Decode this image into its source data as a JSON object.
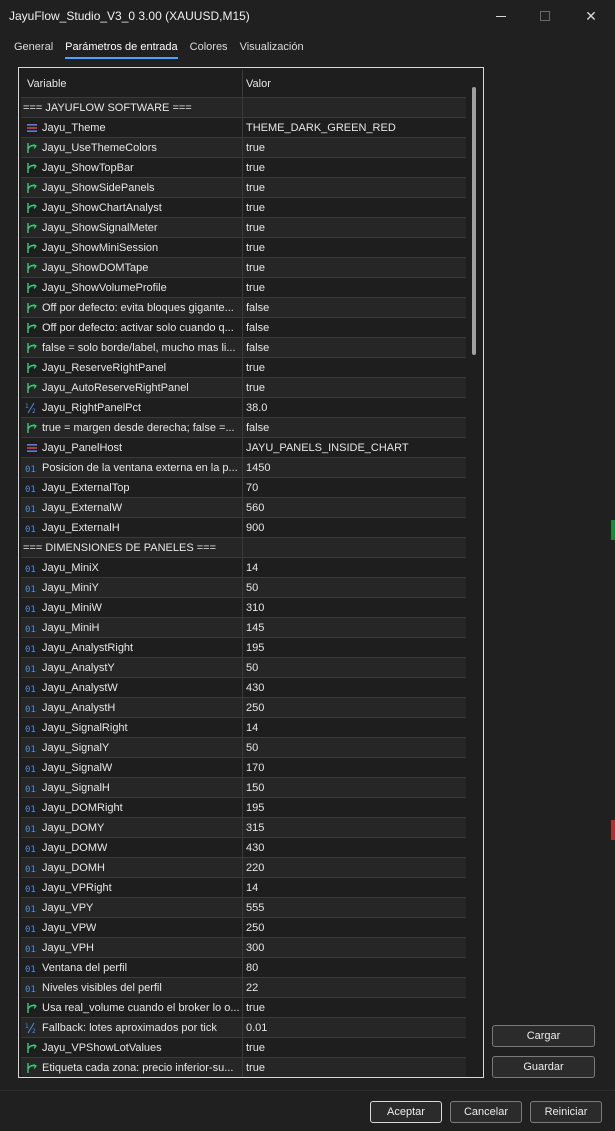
{
  "window": {
    "title": "JayuFlow_Studio_V3_0 3.00 (XAUUSD,M15)"
  },
  "tabs": [
    {
      "label": "General"
    },
    {
      "label": "Parámetros de entrada"
    },
    {
      "label": "Colores"
    },
    {
      "label": "Visualización"
    }
  ],
  "active_tab": "Parámetros de entrada",
  "table": {
    "col_variable": "Variable",
    "col_valor": "Valor",
    "rows": [
      {
        "icon": "none",
        "name": "=== JAYUFLOW SOFTWARE ===",
        "value": ""
      },
      {
        "icon": "enum-icon",
        "name": "Jayu_Theme",
        "value": "THEME_DARK_GREEN_RED"
      },
      {
        "icon": "bool-icon",
        "name": "Jayu_UseThemeColors",
        "value": "true"
      },
      {
        "icon": "bool-icon",
        "name": "Jayu_ShowTopBar",
        "value": "true"
      },
      {
        "icon": "bool-icon",
        "name": "Jayu_ShowSidePanels",
        "value": "true"
      },
      {
        "icon": "bool-icon",
        "name": "Jayu_ShowChartAnalyst",
        "value": "true"
      },
      {
        "icon": "bool-icon",
        "name": "Jayu_ShowSignalMeter",
        "value": "true"
      },
      {
        "icon": "bool-icon",
        "name": "Jayu_ShowMiniSession",
        "value": "true"
      },
      {
        "icon": "bool-icon",
        "name": "Jayu_ShowDOMTape",
        "value": "true"
      },
      {
        "icon": "bool-icon",
        "name": "Jayu_ShowVolumeProfile",
        "value": "true"
      },
      {
        "icon": "bool-icon",
        "name": "Off por defecto: evita bloques gigante...",
        "value": "false"
      },
      {
        "icon": "bool-icon",
        "name": "Off por defecto: activar solo cuando q...",
        "value": "false"
      },
      {
        "icon": "bool-icon",
        "name": "false = solo borde/label, mucho mas li...",
        "value": "false"
      },
      {
        "icon": "bool-icon",
        "name": "Jayu_ReserveRightPanel",
        "value": "true"
      },
      {
        "icon": "bool-icon",
        "name": "Jayu_AutoReserveRightPanel",
        "value": "true"
      },
      {
        "icon": "double-icon",
        "name": "Jayu_RightPanelPct",
        "value": "38.0"
      },
      {
        "icon": "bool-icon",
        "name": "true = margen desde derecha; false =...",
        "value": "false"
      },
      {
        "icon": "enum-icon",
        "name": "Jayu_PanelHost",
        "value": "JAYU_PANELS_INSIDE_CHART"
      },
      {
        "icon": "int-icon",
        "name": "Posicion de la ventana externa en la p...",
        "value": "1450"
      },
      {
        "icon": "int-icon",
        "name": "Jayu_ExternalTop",
        "value": "70"
      },
      {
        "icon": "int-icon",
        "name": "Jayu_ExternalW",
        "value": "560"
      },
      {
        "icon": "int-icon",
        "name": "Jayu_ExternalH",
        "value": "900"
      },
      {
        "icon": "none",
        "name": "=== DIMENSIONES DE PANELES ===",
        "value": ""
      },
      {
        "icon": "int-icon",
        "name": "Jayu_MiniX",
        "value": "14"
      },
      {
        "icon": "int-icon",
        "name": "Jayu_MiniY",
        "value": "50"
      },
      {
        "icon": "int-icon",
        "name": "Jayu_MiniW",
        "value": "310"
      },
      {
        "icon": "int-icon",
        "name": "Jayu_MiniH",
        "value": "145"
      },
      {
        "icon": "int-icon",
        "name": "Jayu_AnalystRight",
        "value": "195"
      },
      {
        "icon": "int-icon",
        "name": "Jayu_AnalystY",
        "value": "50"
      },
      {
        "icon": "int-icon",
        "name": "Jayu_AnalystW",
        "value": "430"
      },
      {
        "icon": "int-icon",
        "name": "Jayu_AnalystH",
        "value": "250"
      },
      {
        "icon": "int-icon",
        "name": "Jayu_SignalRight",
        "value": "14"
      },
      {
        "icon": "int-icon",
        "name": "Jayu_SignalY",
        "value": "50"
      },
      {
        "icon": "int-icon",
        "name": "Jayu_SignalW",
        "value": "170"
      },
      {
        "icon": "int-icon",
        "name": "Jayu_SignalH",
        "value": "150"
      },
      {
        "icon": "int-icon",
        "name": "Jayu_DOMRight",
        "value": "195"
      },
      {
        "icon": "int-icon",
        "name": "Jayu_DOMY",
        "value": "315"
      },
      {
        "icon": "int-icon",
        "name": "Jayu_DOMW",
        "value": "430"
      },
      {
        "icon": "int-icon",
        "name": "Jayu_DOMH",
        "value": "220"
      },
      {
        "icon": "int-icon",
        "name": "Jayu_VPRight",
        "value": "14"
      },
      {
        "icon": "int-icon",
        "name": "Jayu_VPY",
        "value": "555"
      },
      {
        "icon": "int-icon",
        "name": "Jayu_VPW",
        "value": "250"
      },
      {
        "icon": "int-icon",
        "name": "Jayu_VPH",
        "value": "300"
      },
      {
        "icon": "int-icon",
        "name": "Ventana del perfil",
        "value": "80"
      },
      {
        "icon": "int-icon",
        "name": "Niveles visibles del perfil",
        "value": "22"
      },
      {
        "icon": "bool-icon",
        "name": "Usa real_volume cuando el broker lo o...",
        "value": "true"
      },
      {
        "icon": "double-icon",
        "name": "Fallback: lotes aproximados por tick",
        "value": "0.01"
      },
      {
        "icon": "bool-icon",
        "name": "Jayu_VPShowLotValues",
        "value": "true"
      },
      {
        "icon": "bool-icon",
        "name": "Etiqueta cada zona: precio inferior-su...",
        "value": "true"
      }
    ]
  },
  "side_buttons": {
    "load": "Cargar",
    "save": "Guardar"
  },
  "footer_buttons": {
    "ok": "Aceptar",
    "cancel": "Cancelar",
    "reset": "Reiniciar"
  },
  "colors": {
    "background": "#202020",
    "accent": "#4ea1ff",
    "bool_icon": "#3cc878",
    "int_icon": "#4a8ee0",
    "enum_icon": "#5a7cd8"
  }
}
